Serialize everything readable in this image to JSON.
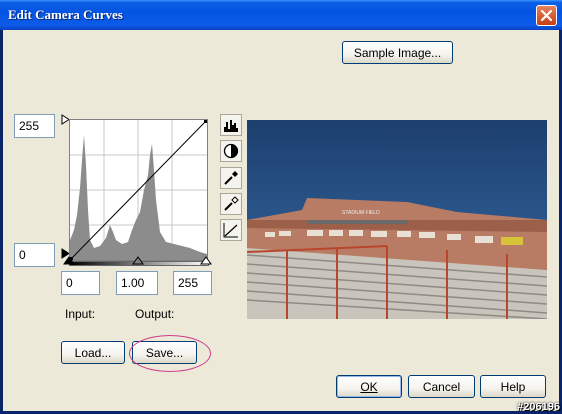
{
  "window": {
    "title": "Edit Camera Curves"
  },
  "buttons": {
    "sample_image": "Sample Image...",
    "load": "Load...",
    "save": "Save...",
    "ok": "OK",
    "cancel": "Cancel",
    "help": "Help"
  },
  "curve": {
    "output_max": "255",
    "output_min": "0",
    "input_black": "0",
    "gamma": "1.00",
    "input_white": "255"
  },
  "labels": {
    "input": "Input:",
    "output": "Output:"
  },
  "tools": [
    "histogram-icon",
    "contrast-icon",
    "black-eyedropper-icon",
    "white-eyedropper-icon",
    "curve-line-icon"
  ],
  "preview": {
    "sign_text": "STADIUM FIELD"
  },
  "watermark": "#206196",
  "colors": {
    "title_bar": "#0454e3",
    "close": "#c53f16",
    "annotation": "#d03c8c"
  }
}
